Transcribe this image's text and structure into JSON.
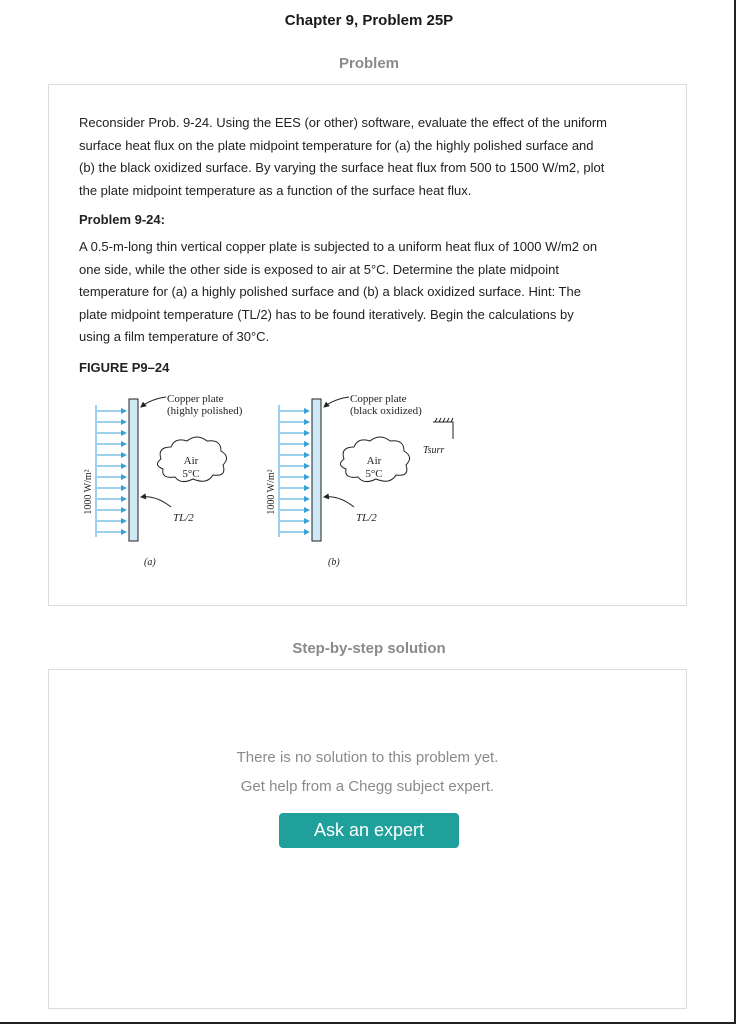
{
  "header": {
    "chapter_title": "Chapter 9, Problem 25P",
    "problem_heading": "Problem",
    "solution_heading": "Step-by-step solution"
  },
  "problem": {
    "intro_lines": [
      "Reconsider Prob. 9-24. Using the EES (or other) software, evaluate the effect of the uniform",
      "surface heat flux on the plate midpoint temperature for (a) the highly polished surface and",
      "(b) the black oxidized surface. By varying the surface heat flux from 500 to 1500 W/m2, plot",
      "the plate midpoint temperature as a function of the surface heat flux."
    ],
    "ref_heading": "Problem 9-24:",
    "ref_lines": [
      "A 0.5-m-long thin vertical copper plate is subjected to a uniform heat flux of 1000 W/m2 on",
      "one side, while the other side is exposed to air at 5°C. Determine the plate midpoint",
      "temperature for (a) a highly polished surface and (b) a black oxidized surface. Hint: The",
      "plate midpoint temperature (TL/2) has to be found iteratively. Begin the calculations by",
      "using a film temperature of 30°C."
    ],
    "figure_caption": "FIGURE P9–24",
    "figure": {
      "flux_label": "1000 W/m²",
      "air_label": "Air",
      "air_temp": "5°C",
      "midpoint_label_a": "TL/2",
      "midpoint_label_b": "TL/2",
      "plate_a_label_1": "Copper plate",
      "plate_a_label_2": "(highly polished)",
      "plate_b_label_1": "Copper plate",
      "plate_b_label_2": "(black oxidized)",
      "surr_label": "Tsurr",
      "sub_a": "(a)",
      "sub_b": "(b)"
    }
  },
  "solution": {
    "line_1": "There is no solution to this problem yet.",
    "line_2": "Get help from a Chegg subject expert.",
    "button_label": "Ask an expert"
  },
  "colors": {
    "accent": "#20a09a",
    "muted": "#8a8a8a",
    "plate_fill": "#cfe9f7",
    "arrow": "#3aa0d8"
  }
}
